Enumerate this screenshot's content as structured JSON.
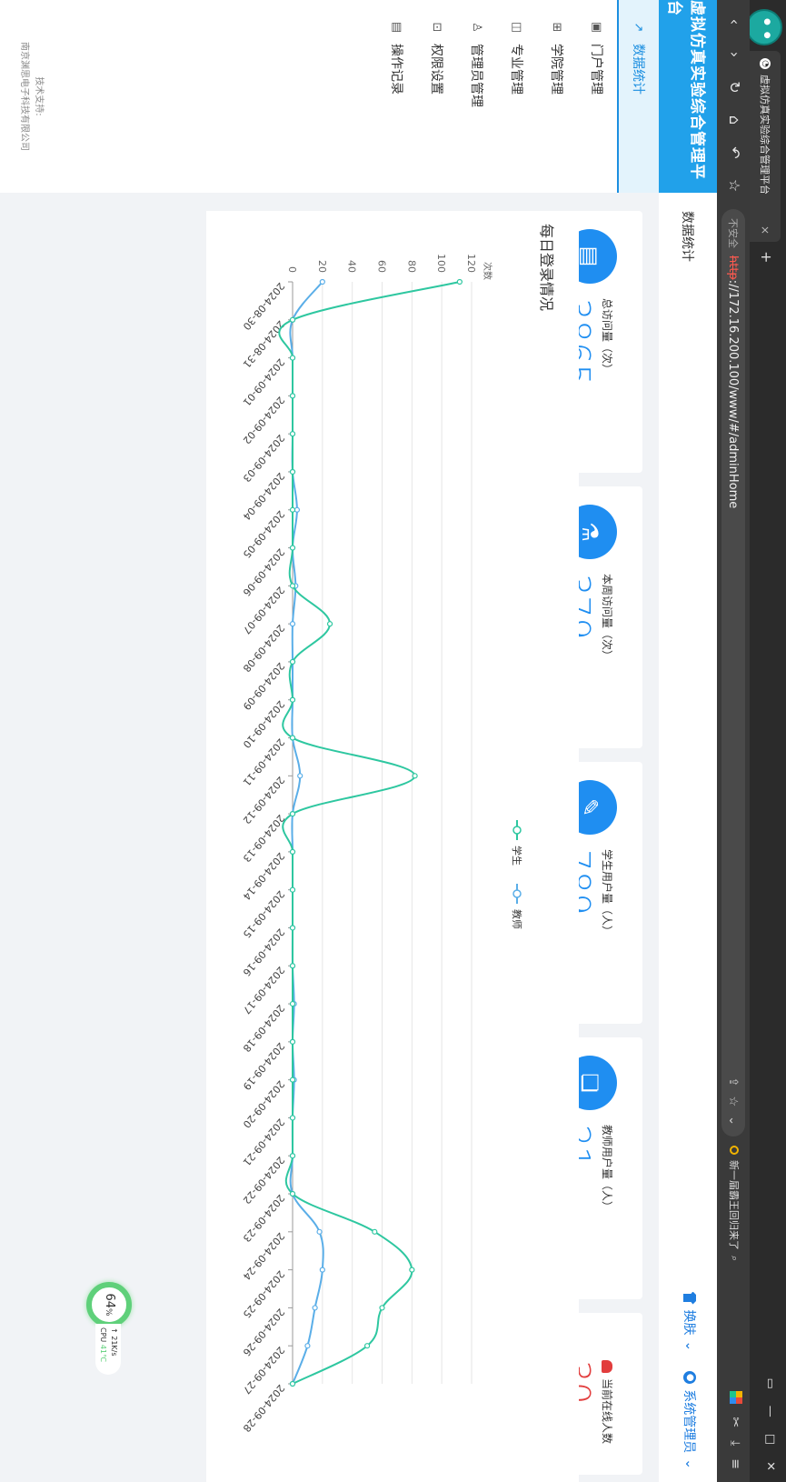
{
  "browser": {
    "tab_title": "虚拟仿真实验综合管理平台",
    "new_tab": "+",
    "url_security": "不安全",
    "url_protocol": "http",
    "url_host": "://172.16.200.100/www/#/adminHome",
    "news": "新一届霸王回归来了"
  },
  "app": {
    "brand": "虚拟仿真实验综合管理平台",
    "breadcrumb": "数据统计",
    "skin_label": "换肤",
    "user_label": "系统管理员"
  },
  "sidebar": {
    "items": [
      {
        "label": "数据统计",
        "icon": "trend-icon"
      },
      {
        "label": "门户管理",
        "icon": "portal-icon"
      },
      {
        "label": "学院管理",
        "icon": "grid-icon"
      },
      {
        "label": "专业管理",
        "icon": "book-icon"
      },
      {
        "label": "管理员管理",
        "icon": "users-icon"
      },
      {
        "label": "权限设置",
        "icon": "lock-icon"
      },
      {
        "label": "操作记录",
        "icon": "log-icon"
      }
    ],
    "support_line1": "技术支持:",
    "support_line2": "南京渊思电子科技有限公司"
  },
  "stats": [
    {
      "label": "总访问量（次）",
      "value": "3865",
      "icon": "monitor-icon"
    },
    {
      "label": "本周访问量（次）",
      "value": "379",
      "icon": "flask-icon"
    },
    {
      "label": "学生用户量（人）",
      "value": "789",
      "icon": "doc-edit-icon"
    },
    {
      "label": "教师用户量（人）",
      "value": "21",
      "icon": "certificate-icon"
    },
    {
      "label": "当前在线人数",
      "value": "30",
      "icon": "people-icon"
    }
  ],
  "cpu_widget": {
    "percent": "64",
    "unit": "%",
    "speed": "21K/s",
    "cpu_label": "CPU",
    "temp": "41℃"
  },
  "chart_data": {
    "type": "line",
    "title": "每日登录情况",
    "ylabel": "次数",
    "ylim": [
      0,
      120
    ],
    "yticks": [
      0,
      20,
      40,
      60,
      80,
      100,
      120
    ],
    "legend_position": "top-center",
    "categories": [
      "2024-08-30",
      "2024-08-31",
      "2024-09-01",
      "2024-09-02",
      "2024-09-03",
      "2024-09-04",
      "2024-09-05",
      "2024-09-06",
      "2024-09-07",
      "2024-09-08",
      "2024-09-09",
      "2024-09-10",
      "2024-09-11",
      "2024-09-12",
      "2024-09-13",
      "2024-09-14",
      "2024-09-15",
      "2024-09-16",
      "2024-09-17",
      "2024-09-18",
      "2024-09-19",
      "2024-09-20",
      "2024-09-21",
      "2024-09-22",
      "2024-09-23",
      "2024-09-24",
      "2024-09-25",
      "2024-09-26",
      "2024-09-27",
      "2024-09-28"
    ],
    "series": [
      {
        "name": "学生",
        "color": "#2ec7a0",
        "values": [
          112,
          0,
          0,
          0,
          0,
          0,
          0,
          0,
          0,
          25,
          0,
          0,
          0,
          82,
          0,
          0,
          0,
          0,
          0,
          0,
          0,
          0,
          0,
          0,
          0,
          55,
          80,
          60,
          50,
          0
        ]
      },
      {
        "name": "教师",
        "color": "#5aaee8",
        "values": [
          20,
          0,
          0,
          0,
          0,
          0,
          3,
          0,
          2,
          0,
          0,
          0,
          0,
          5,
          0,
          0,
          0,
          0,
          0,
          1,
          0,
          1,
          0,
          0,
          0,
          18,
          20,
          15,
          10,
          0
        ]
      }
    ]
  }
}
